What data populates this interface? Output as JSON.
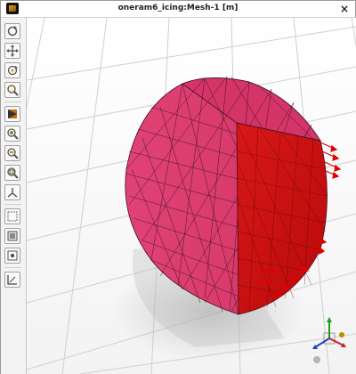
{
  "window": {
    "title": "oneram6_icing:Mesh-1 [m]"
  },
  "titlebar": {
    "app_icon": "app-icon",
    "close_glyph": "×"
  },
  "toolbar": {
    "tools": [
      {
        "name": "rotate-tool",
        "icon": "rotate-icon"
      },
      {
        "name": "pan-tool",
        "icon": "pan-icon"
      },
      {
        "name": "rotate-point-tool",
        "icon": "rotate-point-icon"
      },
      {
        "name": "zoom-tool",
        "icon": "zoom-icon"
      },
      {
        "name": "view-mode-tool",
        "icon": "view-mode-icon"
      },
      {
        "name": "zoom-in-tool",
        "icon": "zoom-in-icon"
      },
      {
        "name": "zoom-out-tool",
        "icon": "zoom-out-icon"
      },
      {
        "name": "zoom-fit-tool",
        "icon": "zoom-fit-icon"
      },
      {
        "name": "axis-tool",
        "icon": "axis-icon"
      },
      {
        "name": "select-box-tool",
        "icon": "select-box-icon"
      },
      {
        "name": "select-region-tool",
        "icon": "select-region-icon"
      },
      {
        "name": "select-point-tool",
        "icon": "select-point-icon"
      },
      {
        "name": "ruler-tool",
        "icon": "ruler-icon"
      }
    ]
  },
  "viewport": {
    "mesh_color": "#d83a6a",
    "mesh_face_color": "#cc1111",
    "mesh_line_color": "#3a1020",
    "vector_color": "#e00000",
    "background_grid_color": "#cfcfcf"
  }
}
